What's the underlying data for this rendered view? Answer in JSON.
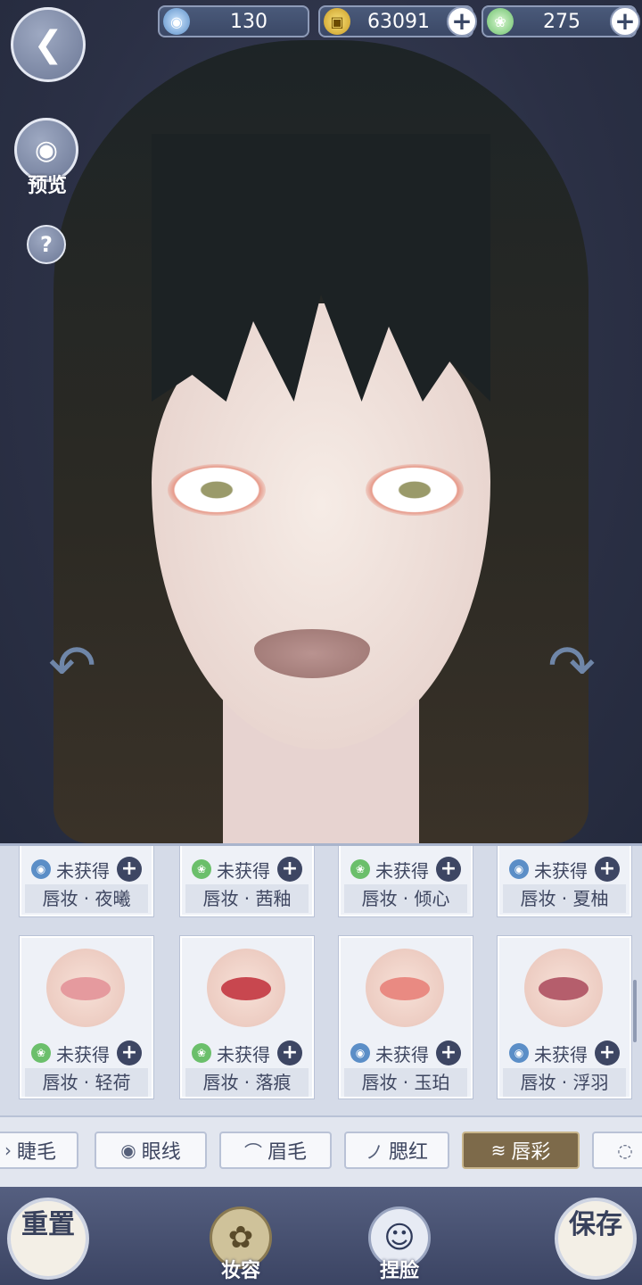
{
  "currency": [
    {
      "icon": "jade-orb-icon",
      "value": "130",
      "has_plus": false
    },
    {
      "icon": "copper-coin-icon",
      "value": "63091",
      "has_plus": true
    },
    {
      "icon": "green-leaf-coin-icon",
      "value": "275",
      "has_plus": true
    }
  ],
  "sidebar": {
    "preview_label": "预览",
    "help_glyph": "?"
  },
  "palette": {
    "row1": [
      {
        "status": "未获得",
        "currency_icon": "jade",
        "name": "唇妆 · 夜曦"
      },
      {
        "status": "未获得",
        "currency_icon": "leaf",
        "name": "唇妆 · 茜釉"
      },
      {
        "status": "未获得",
        "currency_icon": "leaf",
        "name": "唇妆 · 倾心"
      },
      {
        "status": "未获得",
        "currency_icon": "jade",
        "name": "唇妆 · 夏柚"
      }
    ],
    "row2": [
      {
        "status": "未获得",
        "currency_icon": "leaf",
        "name": "唇妆 · 轻荷",
        "lip_color": "#e59a9e"
      },
      {
        "status": "未获得",
        "currency_icon": "leaf",
        "name": "唇妆 · 落痕",
        "lip_color": "#c8474f"
      },
      {
        "status": "未获得",
        "currency_icon": "jade",
        "name": "唇妆 · 玉珀",
        "lip_color": "#e98a82"
      },
      {
        "status": "未获得",
        "currency_icon": "jade",
        "name": "唇妆 · 浮羽",
        "lip_color": "#b55e6c"
      }
    ]
  },
  "tabs": [
    {
      "label": "睫毛",
      "icon": "eyelash-icon"
    },
    {
      "label": "眼线",
      "icon": "eye-icon"
    },
    {
      "label": "眉毛",
      "icon": "eyebrow-icon"
    },
    {
      "label": "腮红",
      "icon": "blush-icon"
    },
    {
      "label": "唇彩",
      "icon": "lips-icon",
      "active": true
    }
  ],
  "bottom": {
    "reset_label": "重置",
    "makeup_label": "妆容",
    "face_label": "捏脸",
    "save_label": "保存"
  }
}
